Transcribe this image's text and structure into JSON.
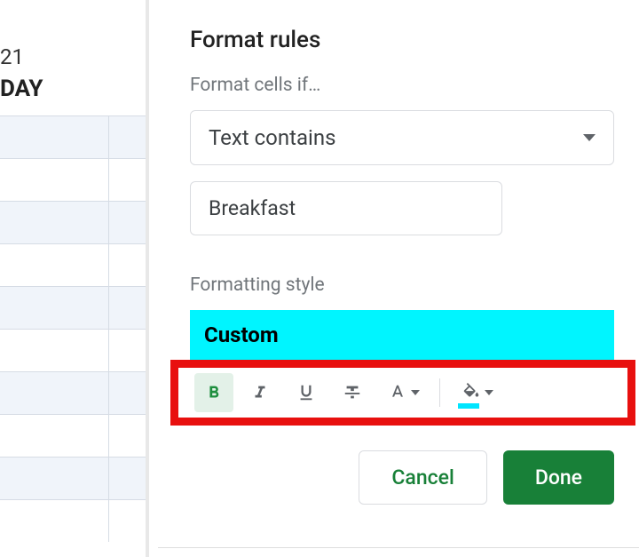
{
  "leftPanel": {
    "dateNumber": "21",
    "dayLabel": "DAY"
  },
  "formatRules": {
    "title": "Format rules",
    "conditionLabel": "Format cells if…",
    "conditionType": "Text contains",
    "conditionValue": "Breakfast",
    "styleLabel": "Formatting style",
    "styleName": "Custom"
  },
  "buttons": {
    "cancel": "Cancel",
    "done": "Done"
  }
}
